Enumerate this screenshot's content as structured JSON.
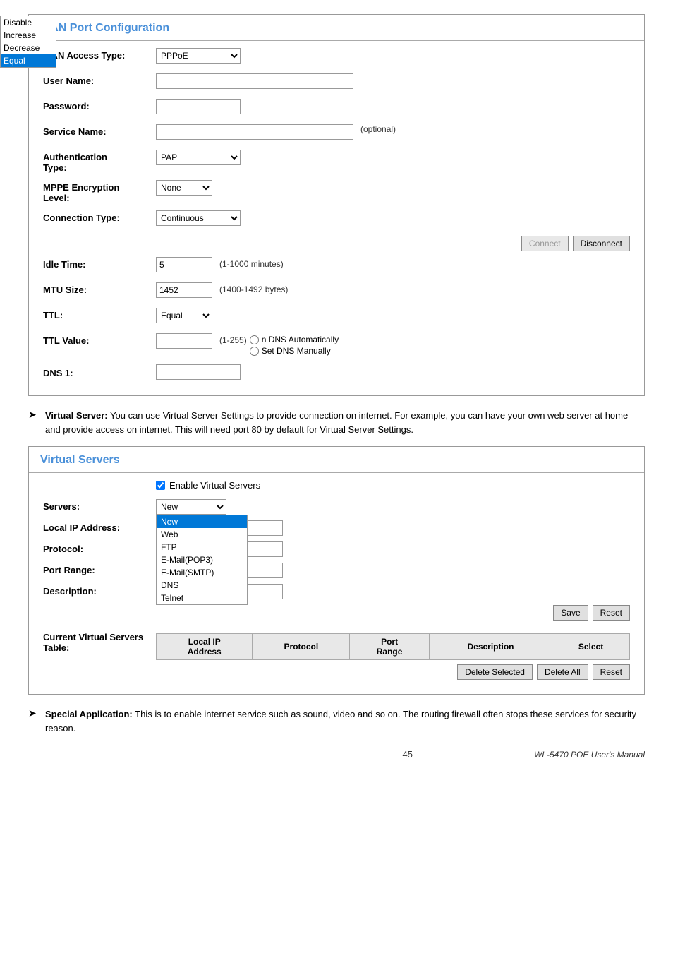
{
  "wan_panel": {
    "title": "WAN Port Configuration",
    "fields": {
      "wan_access_type": {
        "label": "WAN Access Type:",
        "value": "PPPoE"
      },
      "user_name": {
        "label": "User Name:",
        "value": ""
      },
      "password": {
        "label": "Password:",
        "value": ""
      },
      "service_name": {
        "label": "Service Name:",
        "value": "",
        "hint": "(optional)"
      },
      "auth_type": {
        "label": "Authentication Type:",
        "value": "PAP"
      },
      "mppe_encryption": {
        "label": "MPPE Encryption Level:",
        "value": "None"
      },
      "connection_type": {
        "label": "Connection Type:",
        "value": "Continuous"
      },
      "idle_time": {
        "label": "Idle Time:",
        "value": "5",
        "hint": "(1-1000 minutes)"
      },
      "mtu_size": {
        "label": "MTU Size:",
        "value": "1452",
        "hint": "(1400-1492 bytes)"
      },
      "ttl": {
        "label": "TTL:",
        "value": "Equal",
        "options": [
          "Disable",
          "Increase",
          "Decrease",
          "Equal"
        ]
      },
      "ttl_value": {
        "label": "TTL Value:",
        "hint": "(1-255)"
      },
      "dns1": {
        "label": "DNS 1:"
      }
    },
    "buttons": {
      "connect": "Connect",
      "disconnect": "Disconnect"
    },
    "ttl_dropdown_options": [
      "Disable",
      "Increase",
      "Decrease",
      "Equal"
    ],
    "dns_options": {
      "auto": "n DNS Automatically",
      "manual": "Set DNS Manually"
    }
  },
  "bullet1": {
    "prefix": "Virtual Server:",
    "text": " You can use Virtual Server Settings to provide connection on internet. For example, you can have your own web server at home and provide access on internet. This will need port 80 by default for Virtual Server Settings."
  },
  "vs_panel": {
    "title": "Virtual Servers",
    "enable_checkbox": true,
    "enable_label": "Enable Virtual Servers",
    "fields": {
      "servers": {
        "label": "Servers:",
        "value": "New",
        "options": [
          "New",
          "Web",
          "FTP",
          "E-Mail(POP3)",
          "E-Mail(SMTP)",
          "DNS",
          "Telnet"
        ]
      },
      "local_ip": {
        "label": "Local IP Address:",
        "value": ""
      },
      "protocol": {
        "label": "Protocol:",
        "value": ""
      },
      "port_range": {
        "label": "Port Range:",
        "value": ""
      },
      "description": {
        "label": "Description:",
        "value": ""
      }
    },
    "buttons": {
      "save": "Save",
      "reset": "Reset"
    },
    "table": {
      "label": "Current Virtual Servers Table:",
      "columns": [
        "Local IP Address",
        "Protocol",
        "Port Range",
        "Description",
        "Select"
      ]
    },
    "table_buttons": {
      "delete_selected": "Delete Selected",
      "delete_all": "Delete All",
      "reset": "Reset"
    }
  },
  "bullet2": {
    "prefix": "Special Application:",
    "text": " This is to enable internet service such as sound, video and so on. The routing firewall often stops these services for security reason."
  },
  "footer": {
    "page_number": "45",
    "manual_title": "WL-5470 POE",
    "manual_subtitle": "User's Manual"
  }
}
